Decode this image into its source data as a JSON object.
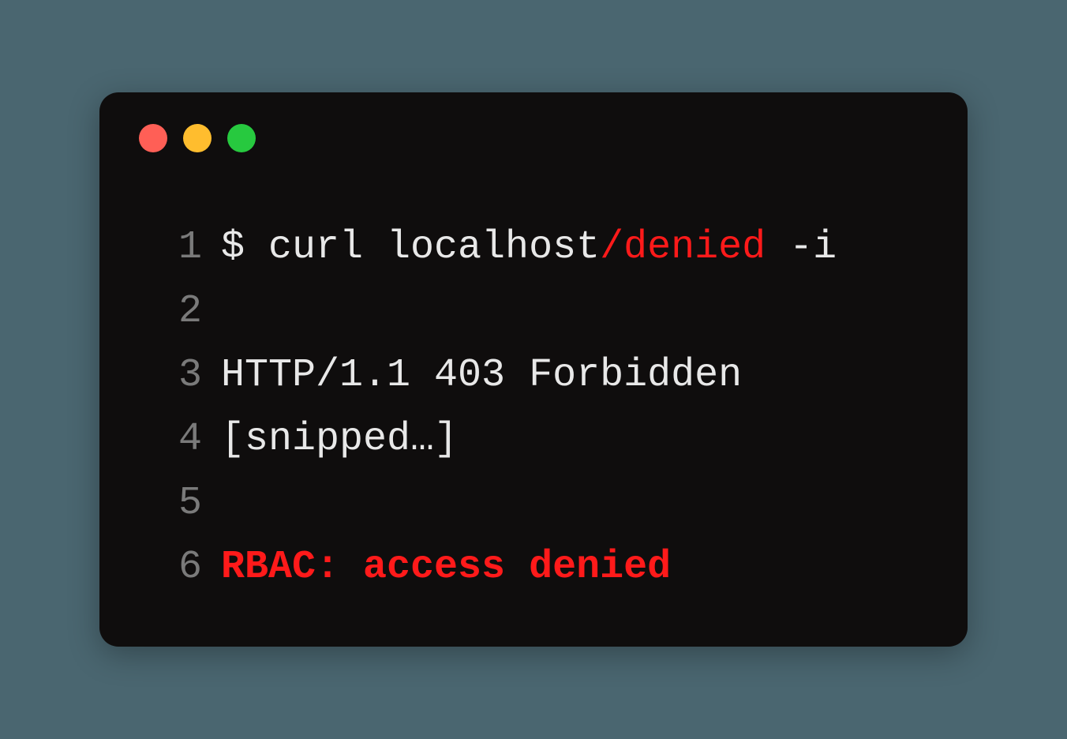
{
  "terminal": {
    "lines": [
      {
        "number": "1",
        "segments": [
          {
            "text": "$ curl localhost",
            "class": ""
          },
          {
            "text": "/denied",
            "class": "red-text"
          },
          {
            "text": " -i",
            "class": ""
          }
        ]
      },
      {
        "number": "2",
        "segments": []
      },
      {
        "number": "3",
        "segments": [
          {
            "text": "HTTP/1.1 403 Forbidden",
            "class": ""
          }
        ]
      },
      {
        "number": "4",
        "segments": [
          {
            "text": "[snipped…]",
            "class": ""
          }
        ]
      },
      {
        "number": "5",
        "segments": []
      },
      {
        "number": "6",
        "segments": [
          {
            "text": "RBAC: access denied",
            "class": "bold-red"
          }
        ]
      }
    ]
  }
}
